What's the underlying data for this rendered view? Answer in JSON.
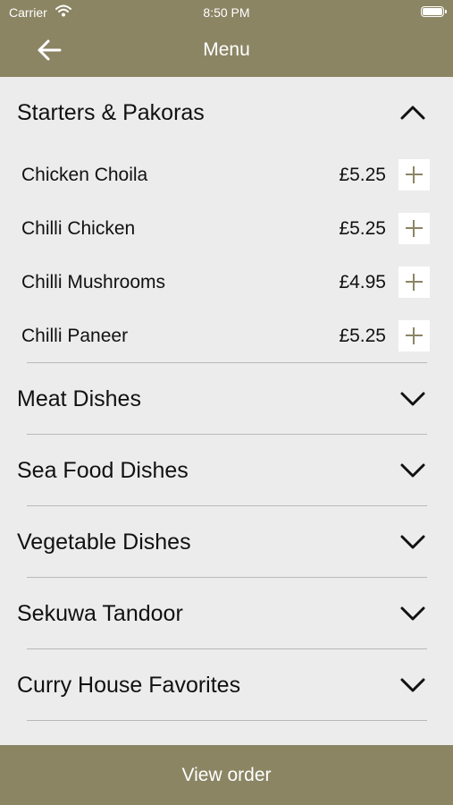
{
  "status_bar": {
    "carrier": "Carrier",
    "time": "8:50 PM"
  },
  "nav": {
    "title": "Menu",
    "back_icon": "arrow-left-icon"
  },
  "categories": [
    {
      "label": "Starters & Pakoras",
      "expanded": true,
      "items": [
        {
          "name": "Chicken Choila",
          "price": "£5.25"
        },
        {
          "name": "Chilli Chicken",
          "price": "£5.25"
        },
        {
          "name": "Chilli Mushrooms",
          "price": "£4.95"
        },
        {
          "name": "Chilli Paneer",
          "price": "£5.25"
        }
      ]
    },
    {
      "label": "Meat Dishes",
      "expanded": false
    },
    {
      "label": "Sea Food Dishes",
      "expanded": false
    },
    {
      "label": "Vegetable Dishes",
      "expanded": false
    },
    {
      "label": "Sekuwa Tandoor",
      "expanded": false
    },
    {
      "label": "Curry House Favorites",
      "expanded": false
    }
  ],
  "footer": {
    "view_order_label": "View order"
  },
  "colors": {
    "brand": "#8b8564",
    "background": "#ececec",
    "divider": "#b9b9b9"
  }
}
